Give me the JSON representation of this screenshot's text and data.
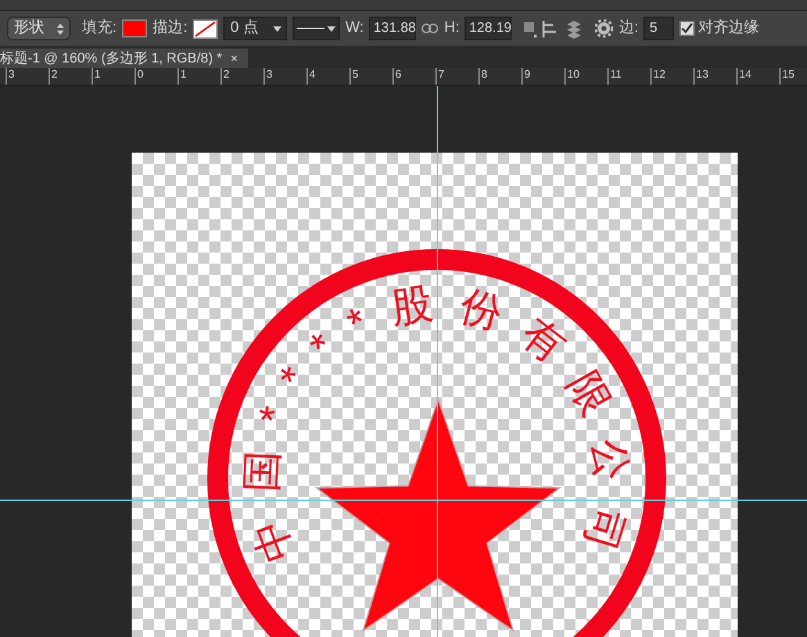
{
  "options_bar": {
    "tool_preset": "形状",
    "fill_label": "填充:",
    "stroke_label": "描边:",
    "stroke_width": "0 点",
    "w_label": "W:",
    "w_value": "131.88",
    "h_label": "H:",
    "h_value": "128.19",
    "sides_label": "边:",
    "sides_value": "5",
    "align_edges": {
      "label": "对齐边缘",
      "checked": true
    }
  },
  "document_tab": {
    "title": "标题-1 @ 160% (多边形 1, RGB/8) *",
    "close": "×"
  },
  "ruler": [
    "3",
    "2",
    "1",
    "0",
    "1",
    "2",
    "3",
    "4",
    "5",
    "6",
    "7",
    "8",
    "9",
    "10",
    "11",
    "12",
    "13",
    "14",
    "15"
  ],
  "canvas": {
    "seal_text": "中国****股份有限公司"
  }
}
